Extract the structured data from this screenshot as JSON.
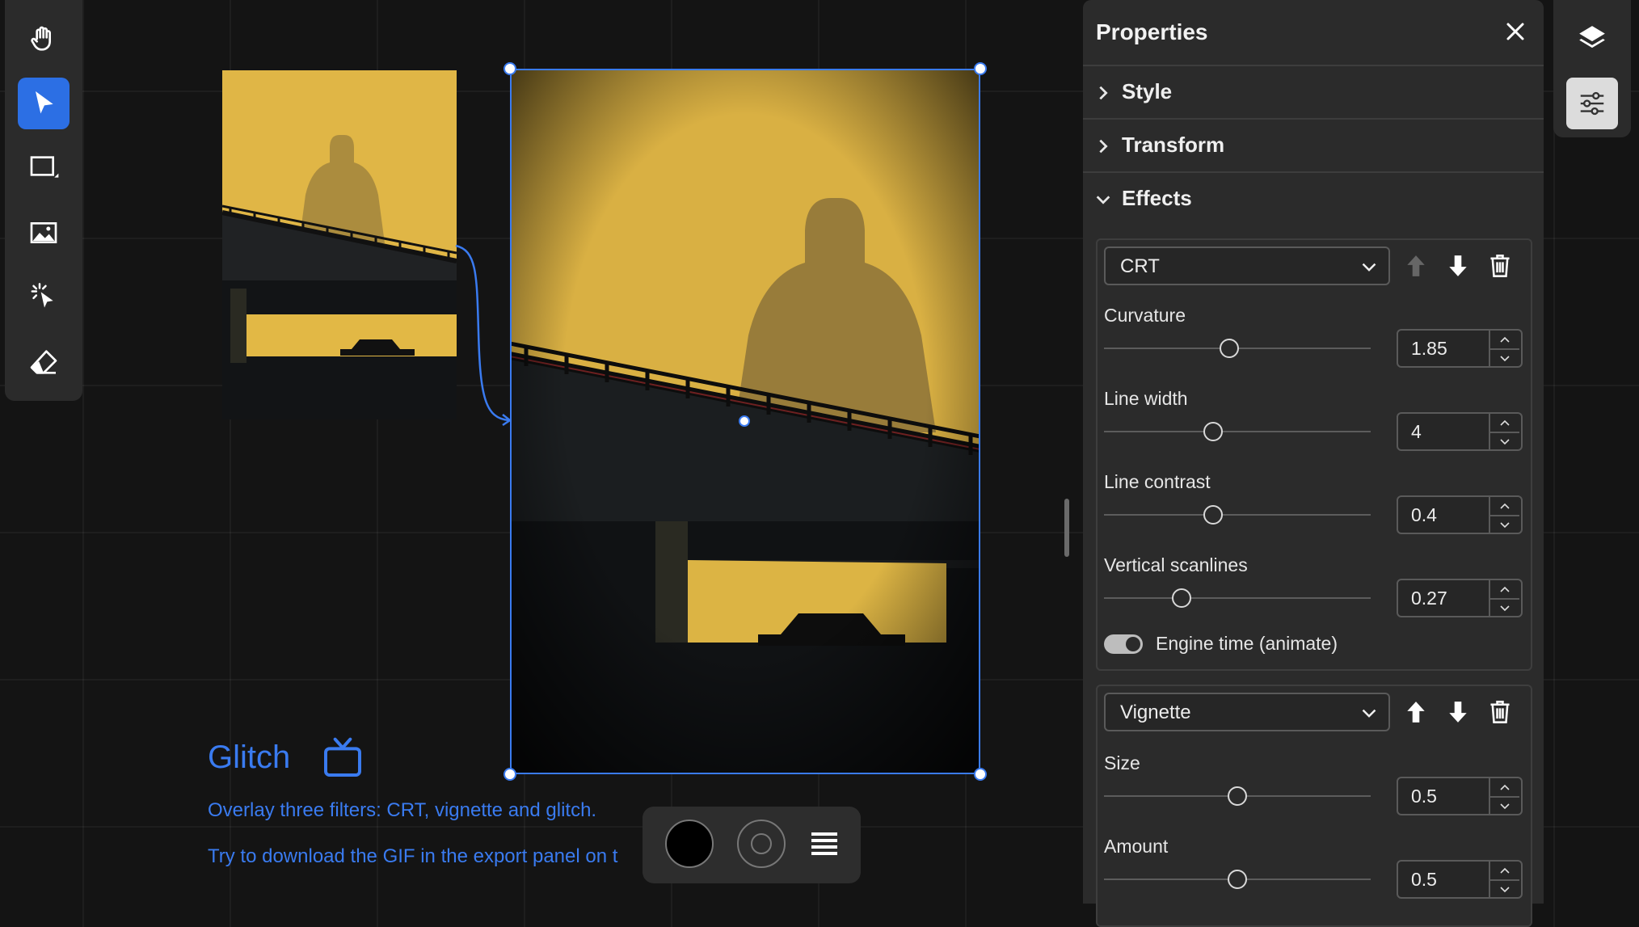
{
  "toolbar": {
    "tools": [
      "hand-tool",
      "select-tool",
      "rectangle-tool",
      "image-tool",
      "magic-select-tool",
      "eraser-tool"
    ],
    "active": "select-tool"
  },
  "canvas": {
    "title": "Glitch",
    "line1": "Overlay three filters: CRT, vignette and glitch.",
    "line2": "Try to download the GIF in the export panel on t"
  },
  "panel": {
    "title": "Properties",
    "sections": {
      "style": "Style",
      "transform": "Transform",
      "effects": "Effects"
    },
    "crt": {
      "type": "CRT",
      "curvature_label": "Curvature",
      "curvature_value": "1.85",
      "line_width_label": "Line width",
      "line_width_value": "4",
      "line_contrast_label": "Line contrast",
      "line_contrast_value": "0.4",
      "vertical_scanlines_label": "Vertical scanlines",
      "vertical_scanlines_value": "0.27",
      "engine_time_label": "Engine time (animate)",
      "engine_time_on": true
    },
    "vignette": {
      "type": "Vignette",
      "size_label": "Size",
      "size_value": "0.5",
      "amount_label": "Amount",
      "amount_value": "0.5"
    }
  },
  "colors": {
    "accent": "#3a7bf0",
    "photo_yellow": "#e2b845",
    "panel_bg": "#2b2b2b"
  }
}
